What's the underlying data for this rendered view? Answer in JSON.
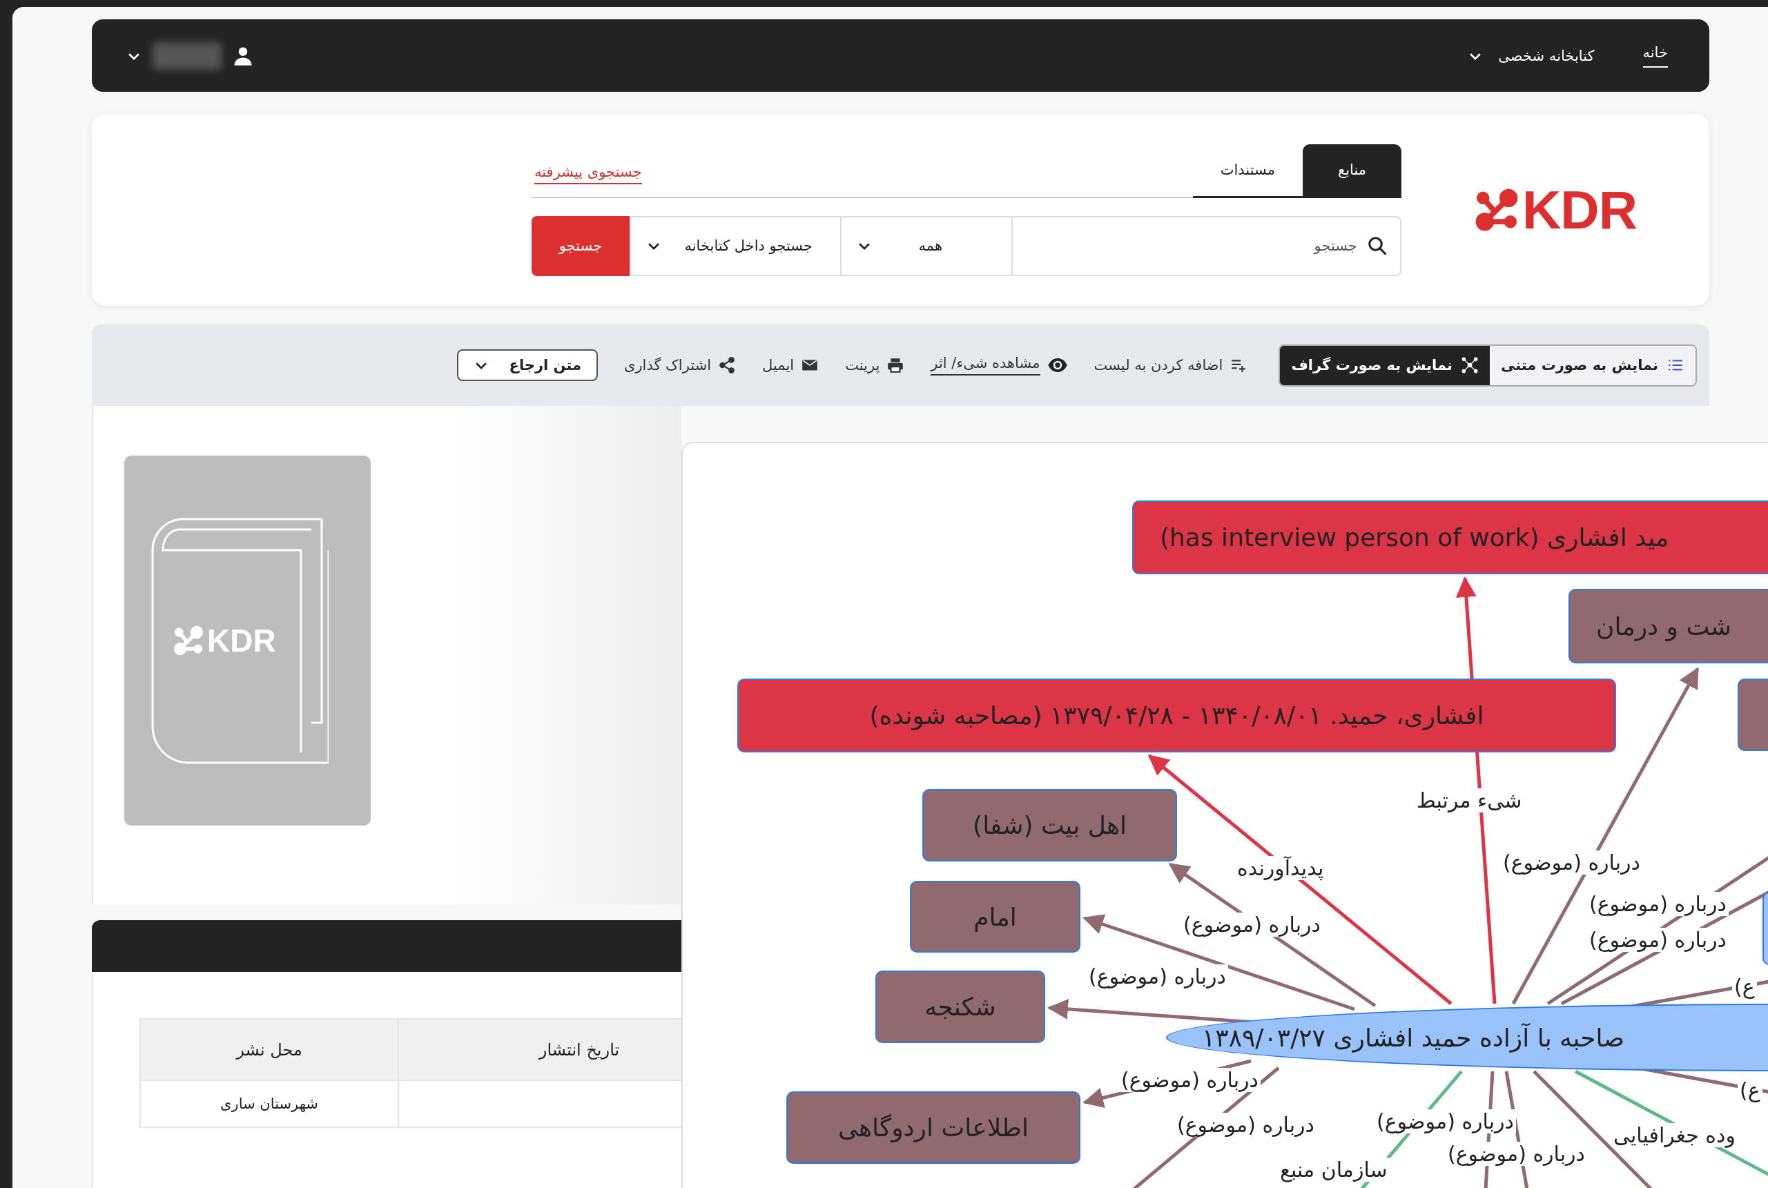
{
  "nav": {
    "items": [
      {
        "label": "خانه",
        "selected": true,
        "kind": "link"
      },
      {
        "label": "کتابخانه شخصی",
        "selected": false,
        "kind": "menu"
      }
    ]
  },
  "search": {
    "logo": "KDR",
    "tabs": [
      {
        "label": "منابع",
        "selected": true
      },
      {
        "label": "مستندات",
        "selected": false
      }
    ],
    "advanced_link": "جستجوی پیشرفته",
    "placeholder": "جستجو",
    "scope": "همه",
    "location": "جستجو داخل کتابخانه",
    "button": "جستجو"
  },
  "toolbar": {
    "views": [
      {
        "label": "نمایش به صورت متنی",
        "selected": false,
        "kind": "list"
      },
      {
        "label": "نمایش به صورت گراف",
        "selected": true,
        "kind": "graph"
      }
    ],
    "actions": [
      {
        "label": "اضافه کردن به لیست",
        "kind": "add"
      },
      {
        "label": "مشاهده شیء/ اثر",
        "kind": "view"
      },
      {
        "label": "پرینت",
        "kind": "print"
      },
      {
        "label": "ایمیل",
        "kind": "email"
      },
      {
        "label": "اشتراک گذاری",
        "kind": "share"
      }
    ],
    "citation": "متن ارجاع"
  },
  "cover": {
    "logo": "KDR"
  },
  "table": {
    "columns": [
      "تاریخ انتشار",
      "محل نشر"
    ],
    "rows": [
      {
        "place": "شهرستان ساری"
      }
    ]
  },
  "graph": {
    "nodes": [
      {
        "kind": "related",
        "text": "مید افشاری (has interview person of work)"
      },
      {
        "kind": "subject",
        "text": "شت و درمان"
      },
      {
        "kind": "subject"
      },
      {
        "kind": "related",
        "text": "افشاری، حمید. ۱۳۴۰/۰۸/۰۱ - ۱۳۷۹/۰۴/۲۸ (مصاحبه شونده)"
      },
      {
        "kind": "subject",
        "text": "اهل بیت (شفا)"
      },
      {
        "kind": "subject",
        "text": "امام"
      },
      {
        "kind": "subject",
        "text": "شکنجه"
      },
      {
        "kind": "subject",
        "text": "اطلاعات اردوگاهی"
      },
      {
        "kind": "other"
      },
      {
        "kind": "center",
        "text": "صاحبه با آزاده حمید افشاری ۱۳۸۹/۰۳/۲۷"
      }
    ],
    "edge_labels": [
      "شیء مرتبط",
      "پدیدآورنده",
      "درباره (موضوع)",
      "درباره (موضوع)",
      "درباره (موضوع)",
      "درباره (موضوع)",
      "درباره (موضوع)",
      "ع)",
      "درباره (موضوع)",
      "ع)",
      "درباره (موضوع)",
      "درباره (موضوع)",
      "وده جغرافیایی",
      "درباره (موضوع)",
      "سازمان منبع"
    ]
  }
}
